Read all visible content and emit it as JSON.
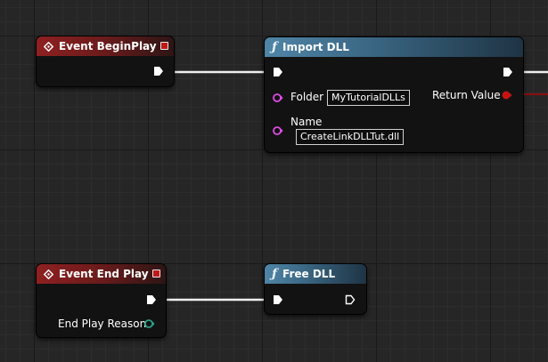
{
  "nodes": {
    "event_beginplay": {
      "title": "Event BeginPlay"
    },
    "import_dll": {
      "title": "Import DLL",
      "folder_label": "Folder",
      "folder_value": "MyTutorialDLLs",
      "name_label": "Name",
      "name_value": "CreateLinkDLLTut.dll",
      "return_label": "Return Value"
    },
    "event_endplay": {
      "title": "Event End Play",
      "reason_label": "End Play Reason"
    },
    "free_dll": {
      "title": "Free DLL"
    }
  },
  "icons": {
    "event": "event-diamond-icon",
    "function": "function-f-icon",
    "exec": "exec-arrow-icon"
  },
  "colors": {
    "event_header": "#8e2021",
    "function_header": "#4f85a6",
    "string_pin": "#e14ce6",
    "enum_pin": "#2aa088",
    "return_pin": "#c41515"
  }
}
